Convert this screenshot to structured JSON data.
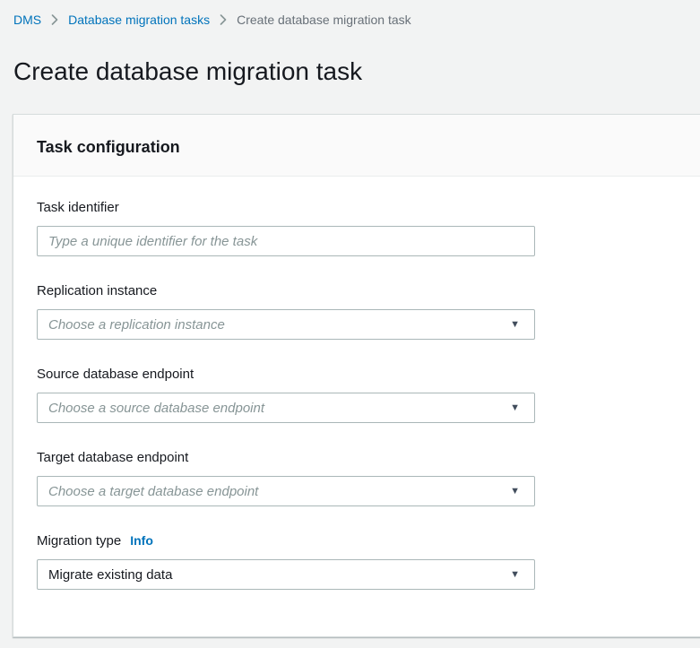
{
  "breadcrumb": {
    "items": [
      {
        "label": "DMS"
      },
      {
        "label": "Database migration tasks"
      },
      {
        "label": "Create database migration task"
      }
    ]
  },
  "page": {
    "title": "Create database migration task"
  },
  "panel": {
    "title": "Task configuration",
    "fields": {
      "task_identifier": {
        "label": "Task identifier",
        "placeholder": "Type a unique identifier for the task"
      },
      "replication_instance": {
        "label": "Replication instance",
        "placeholder": "Choose a replication instance"
      },
      "source_database_endpoint": {
        "label": "Source database endpoint",
        "placeholder": "Choose a source database endpoint"
      },
      "target_database_endpoint": {
        "label": "Target database endpoint",
        "placeholder": "Choose a target database endpoint"
      },
      "migration_type": {
        "label": "Migration type",
        "info_label": "Info",
        "value": "Migrate existing data"
      }
    }
  },
  "icons": {
    "breadcrumb_separator": "chevron-right-icon",
    "select_caret": "caret-down-icon",
    "caret_glyph": "▼"
  },
  "colors": {
    "link": "#0073bb",
    "heading": "#16191f",
    "page_background": "#f2f3f3",
    "panel_header_background": "#fafafa",
    "panel_border": "#d5dbdb",
    "panel_divider": "#eaeded",
    "input_border": "#aab7b8",
    "placeholder_text": "#879596",
    "breadcrumb_current": "#687078",
    "caret": "#414d5c"
  }
}
